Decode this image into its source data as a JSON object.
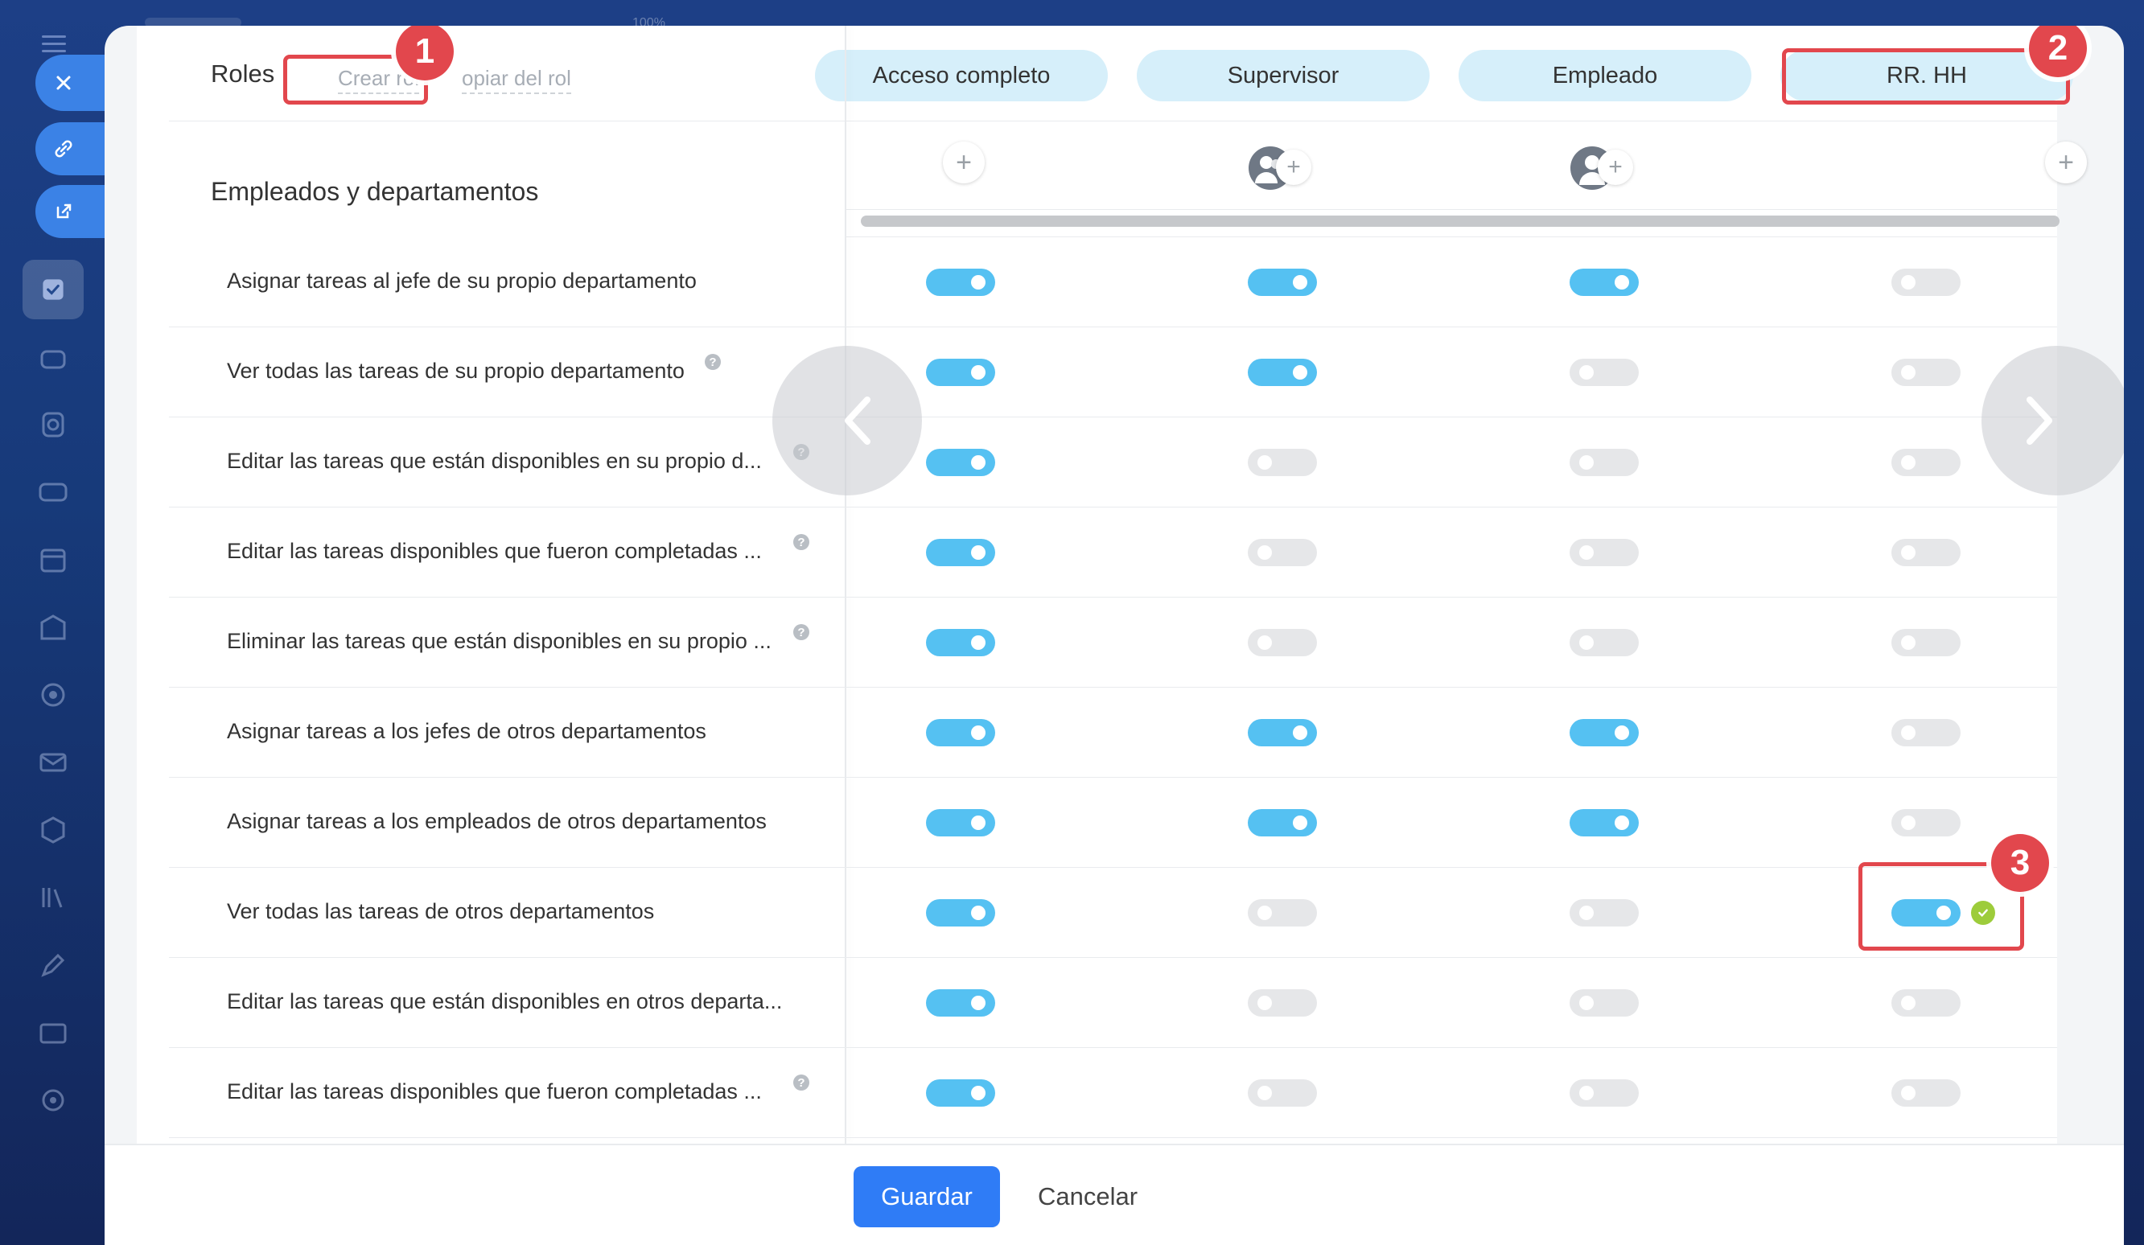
{
  "colors": {
    "accent": "#55c1f2",
    "primary_button": "#2f7cf6",
    "annotation": "#e2474d",
    "success": "#9dcc3b"
  },
  "background": {
    "zoom_hint": "100%"
  },
  "header": {
    "title": "Roles",
    "create_role_link": "Crear rol",
    "copy_role_link": "opiar del rol"
  },
  "roles": [
    {
      "label": "Acceso completo"
    },
    {
      "label": "Supervisor"
    },
    {
      "label": "Empleado"
    },
    {
      "label": "RR. HH"
    }
  ],
  "section": {
    "title": "Empleados y departamentos"
  },
  "rows": [
    {
      "label": "Asignar tareas al jefe de su propio departamento",
      "help": false,
      "toggles": [
        true,
        true,
        true,
        false
      ]
    },
    {
      "label": "Ver todas las tareas de su propio departamento",
      "help": true,
      "toggles": [
        true,
        true,
        false,
        false
      ]
    },
    {
      "label": "Editar las tareas que están disponibles en su propio d...",
      "help": true,
      "toggles": [
        true,
        false,
        false,
        false
      ]
    },
    {
      "label": "Editar las tareas disponibles que fueron completadas ...",
      "help": true,
      "toggles": [
        true,
        false,
        false,
        false
      ]
    },
    {
      "label": "Eliminar las tareas que están disponibles en su propio ...",
      "help": true,
      "toggles": [
        true,
        false,
        false,
        false
      ]
    },
    {
      "label": "Asignar tareas a los jefes de otros departamentos",
      "help": false,
      "toggles": [
        true,
        true,
        true,
        false
      ]
    },
    {
      "label": "Asignar tareas a los empleados de otros departamentos",
      "help": false,
      "toggles": [
        true,
        true,
        true,
        false
      ]
    },
    {
      "label": "Ver todas las tareas de otros departamentos",
      "help": false,
      "toggles": [
        true,
        false,
        false,
        true
      ]
    },
    {
      "label": "Editar las tareas que están disponibles en otros departa...",
      "help": false,
      "toggles": [
        true,
        false,
        false,
        false
      ]
    },
    {
      "label": "Editar las tareas disponibles que fueron completadas ...",
      "help": true,
      "toggles": [
        true,
        false,
        false,
        false
      ]
    }
  ],
  "annotations": [
    "1",
    "2",
    "3"
  ],
  "footer": {
    "save_label": "Guardar",
    "cancel_label": "Cancelar"
  },
  "icons": {
    "close": "close-icon",
    "link": "link-icon",
    "open": "open-external-icon",
    "help": "?"
  }
}
